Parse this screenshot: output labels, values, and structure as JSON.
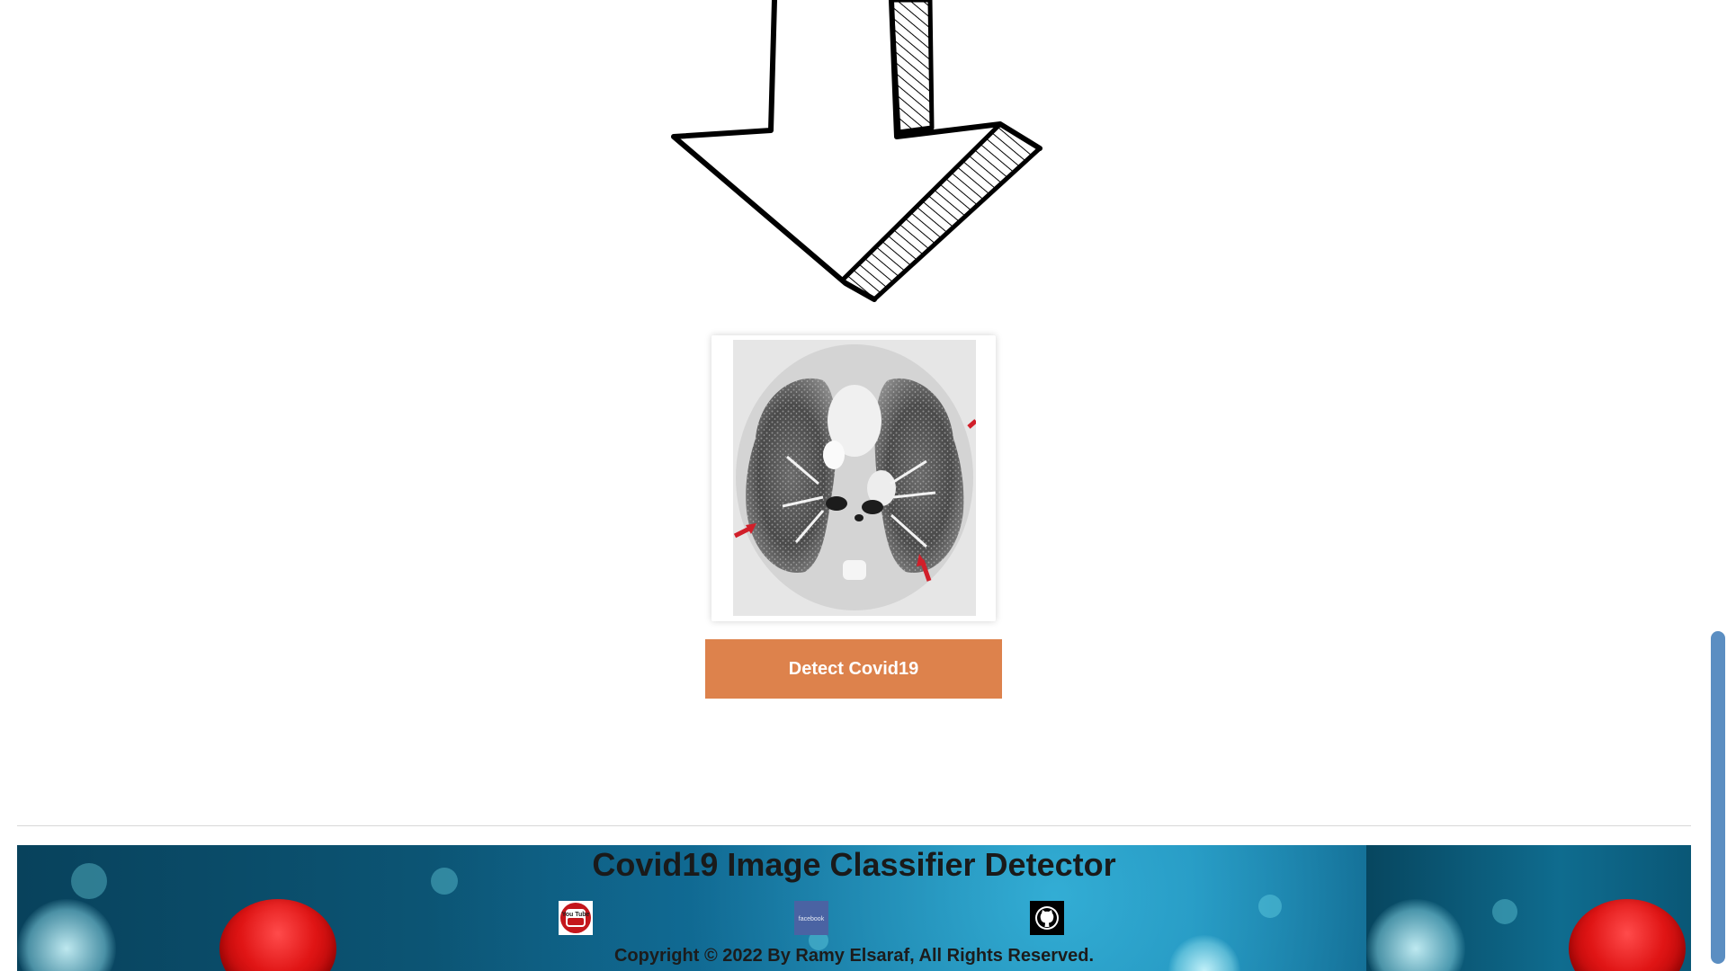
{
  "main": {
    "detect_button_label": "Detect Covid19"
  },
  "footer": {
    "title": "Covid19 Image Classifier Detector",
    "social_links": [
      {
        "name": "youtube",
        "icon": "youtube-icon",
        "text": "You Tube"
      },
      {
        "name": "facebook",
        "icon": "facebook-icon",
        "text": "facebook"
      },
      {
        "name": "github",
        "icon": "github-icon"
      }
    ],
    "copyright": "Copyright © 2022 By Ramy Elsaraf, All Rights Reserved."
  },
  "colors": {
    "button": "#dd824c",
    "scrollbar_thumb": "#5b8ec2",
    "footer_bg": "#0f6488"
  }
}
